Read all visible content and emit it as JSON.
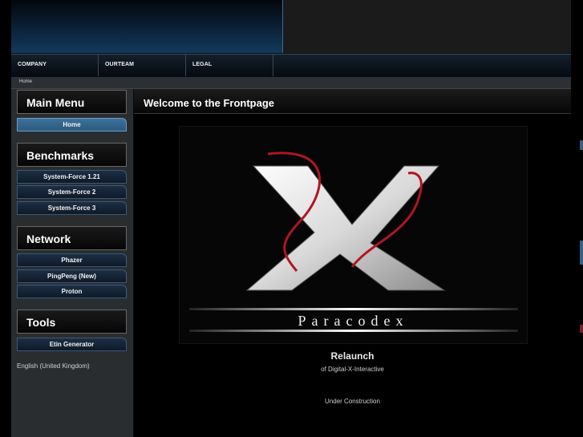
{
  "topnav": {
    "items": [
      {
        "label": "COMPANY"
      },
      {
        "label": "OURTEAM"
      },
      {
        "label": "LEGAL"
      }
    ]
  },
  "breadcrumb": {
    "home": "Home"
  },
  "sidebar": {
    "main_menu": {
      "title": "Main Menu",
      "items": [
        {
          "label": "Home",
          "active": true
        }
      ]
    },
    "benchmarks": {
      "title": "Benchmarks",
      "items": [
        {
          "label": "System-Force 1.21"
        },
        {
          "label": "System-Force 2"
        },
        {
          "label": "System-Force 3"
        }
      ]
    },
    "network": {
      "title": "Network",
      "items": [
        {
          "label": "Phazer"
        },
        {
          "label": "PingPeng (New)"
        },
        {
          "label": "Proton"
        }
      ]
    },
    "tools": {
      "title": "Tools",
      "items": [
        {
          "label": "Etin Generator"
        }
      ]
    },
    "language": "English (United Kingdom)"
  },
  "main": {
    "title": "Welcome to the Frontpage",
    "logo_word": "Paracodex",
    "relaunch": "Relaunch",
    "relaunch_sub": "of Digital-X-Interactive",
    "construction": "Under Construction"
  },
  "colors": {
    "accent_blue": "#3e7299",
    "logo_red": "#b01622"
  }
}
